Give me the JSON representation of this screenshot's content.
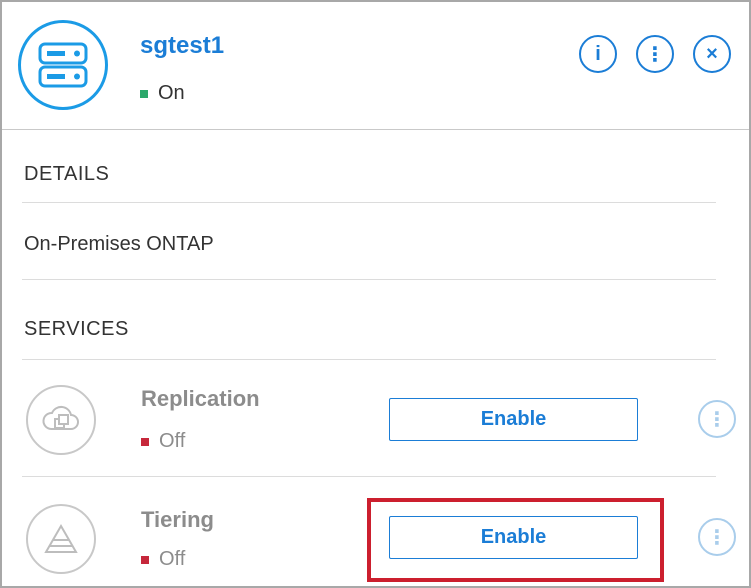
{
  "environment": {
    "name": "sgtest1",
    "status": "On",
    "status_color": "#2ca86b",
    "icon": "storage-server-icon"
  },
  "header_actions": {
    "info_label": "i",
    "more_label": "⋮",
    "close_label": "×"
  },
  "details": {
    "title": "DETAILS",
    "type": "On-Premises ONTAP"
  },
  "services": {
    "title": "SERVICES",
    "items": [
      {
        "name": "Replication",
        "status": "Off",
        "button": "Enable",
        "icon": "cloud-replication-icon",
        "more": "⋮"
      },
      {
        "name": "Tiering",
        "status": "Off",
        "button": "Enable",
        "icon": "tiering-pyramid-icon",
        "more": "⋮"
      }
    ]
  },
  "colors": {
    "accent": "#1b7dd6",
    "highlight": "#cc1f2e",
    "status_off": "#c6283b"
  }
}
